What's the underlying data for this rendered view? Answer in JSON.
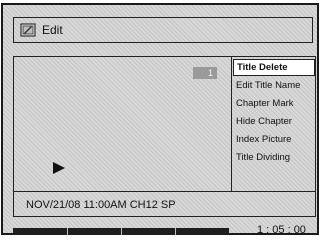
{
  "header": {
    "title": "Edit",
    "icon": "edit-icon"
  },
  "preview": {
    "title_number": "1",
    "status_icon": "play-icon"
  },
  "menu": {
    "items": [
      {
        "label": "Title Delete",
        "selected": true
      },
      {
        "label": "Edit Title Name",
        "selected": false
      },
      {
        "label": "Chapter Mark",
        "selected": false
      },
      {
        "label": "Hide Chapter",
        "selected": false
      },
      {
        "label": "Index Picture",
        "selected": false
      },
      {
        "label": "Title Dividing",
        "selected": false
      }
    ]
  },
  "info_bar": {
    "text": "NOV/21/08 11:00AM CH12 SP"
  },
  "playback": {
    "time": "1 : 05 : 00"
  },
  "colors": {
    "background": "#d9d9d9",
    "border": "#1a1a1a",
    "progress": "#1e1e1e",
    "badge": "#9a9a9a"
  }
}
